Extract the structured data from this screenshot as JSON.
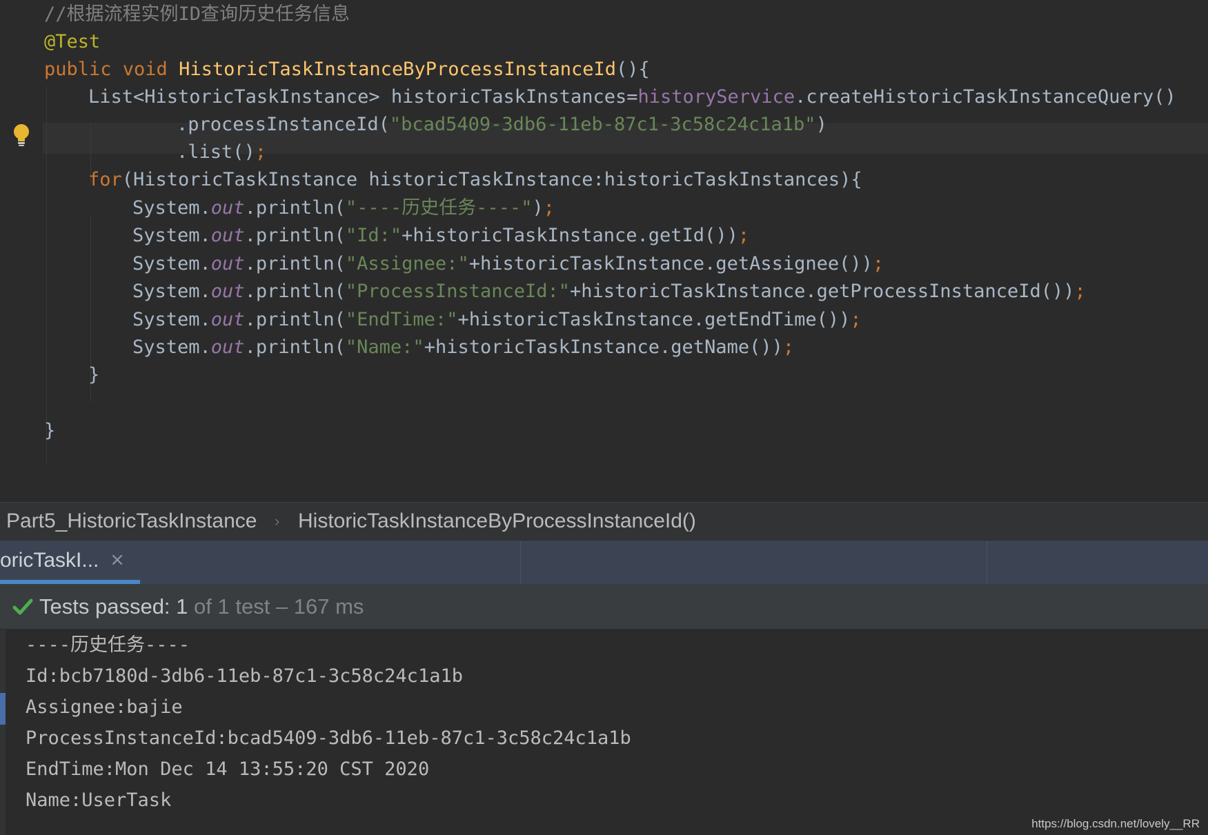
{
  "editor": {
    "lines": [
      {
        "tokens": [
          {
            "t": "comment",
            "v": "//根据流程实例ID查询历史任务信息"
          }
        ]
      },
      {
        "tokens": [
          {
            "t": "annot",
            "v": "@Test"
          }
        ]
      },
      {
        "tokens": [
          {
            "t": "kw",
            "v": "public void "
          },
          {
            "t": "method",
            "v": "HistoricTaskInstanceByProcessInstanceId"
          },
          {
            "t": "plain",
            "v": "(){"
          }
        ]
      },
      {
        "tokens": [
          {
            "t": "plain",
            "v": "List<HistoricTaskInstance> historicTaskInstances="
          },
          {
            "t": "field",
            "v": "historyService"
          },
          {
            "t": "plain",
            "v": ".createHistoricTaskInstanceQuery()"
          }
        ]
      },
      {
        "tokens": [
          {
            "t": "plain",
            "v": ".processInstanceId("
          },
          {
            "t": "str",
            "v": "\"bcad5409-3db6-11eb-87c1-3c58c24c1a1b\""
          },
          {
            "t": "plain",
            "v": ")"
          }
        ]
      },
      {
        "tokens": [
          {
            "t": "plain",
            "v": ".list()"
          },
          {
            "t": "semi",
            "v": ";"
          }
        ]
      },
      {
        "tokens": [
          {
            "t": "kw",
            "v": "for"
          },
          {
            "t": "plain",
            "v": "(HistoricTaskInstance historicTaskInstance:historicTaskInstances){"
          }
        ]
      },
      {
        "tokens": [
          {
            "t": "plain",
            "v": "System."
          },
          {
            "t": "static",
            "v": "out"
          },
          {
            "t": "plain",
            "v": ".println("
          },
          {
            "t": "str",
            "v": "\"----历史任务----\""
          },
          {
            "t": "plain",
            "v": ")"
          },
          {
            "t": "semi",
            "v": ";"
          }
        ]
      },
      {
        "tokens": [
          {
            "t": "plain",
            "v": "System."
          },
          {
            "t": "static",
            "v": "out"
          },
          {
            "t": "plain",
            "v": ".println("
          },
          {
            "t": "str",
            "v": "\"Id:\""
          },
          {
            "t": "plain",
            "v": "+historicTaskInstance.getId())"
          },
          {
            "t": "semi",
            "v": ";"
          }
        ]
      },
      {
        "tokens": [
          {
            "t": "plain",
            "v": "System."
          },
          {
            "t": "static",
            "v": "out"
          },
          {
            "t": "plain",
            "v": ".println("
          },
          {
            "t": "str",
            "v": "\"Assignee:\""
          },
          {
            "t": "plain",
            "v": "+historicTaskInstance.getAssignee())"
          },
          {
            "t": "semi",
            "v": ";"
          }
        ]
      },
      {
        "tokens": [
          {
            "t": "plain",
            "v": "System."
          },
          {
            "t": "static",
            "v": "out"
          },
          {
            "t": "plain",
            "v": ".println("
          },
          {
            "t": "str",
            "v": "\"ProcessInstanceId:\""
          },
          {
            "t": "plain",
            "v": "+historicTaskInstance.getProcessInstanceId())"
          },
          {
            "t": "semi",
            "v": ";"
          }
        ]
      },
      {
        "tokens": [
          {
            "t": "plain",
            "v": "System."
          },
          {
            "t": "static",
            "v": "out"
          },
          {
            "t": "plain",
            "v": ".println("
          },
          {
            "t": "str",
            "v": "\"EndTime:\""
          },
          {
            "t": "plain",
            "v": "+historicTaskInstance.getEndTime())"
          },
          {
            "t": "semi",
            "v": ";"
          }
        ]
      },
      {
        "tokens": [
          {
            "t": "plain",
            "v": "System."
          },
          {
            "t": "static",
            "v": "out"
          },
          {
            "t": "plain",
            "v": ".println("
          },
          {
            "t": "str",
            "v": "\"Name:\""
          },
          {
            "t": "plain",
            "v": "+historicTaskInstance.getName())"
          },
          {
            "t": "semi",
            "v": ";"
          }
        ]
      },
      {
        "tokens": [
          {
            "t": "plain",
            "v": "}"
          }
        ]
      },
      {
        "tokens": []
      },
      {
        "tokens": [
          {
            "t": "plain",
            "v": "}"
          }
        ]
      }
    ]
  },
  "breadcrumb": {
    "class_name": "Part5_HistoricTaskInstance",
    "separator": "›",
    "method_name": "HistoricTaskInstanceByProcessInstanceId()"
  },
  "run_panel": {
    "tab_label": "oricTaskI...",
    "tab_close": "×",
    "status_main": "Tests passed: 1",
    "status_sub": " of 1 test – 167 ms",
    "console_lines": [
      "----历史任务----",
      "Id:bcb7180d-3db6-11eb-87c1-3c58c24c1a1b",
      "Assignee:bajie",
      "ProcessInstanceId:bcad5409-3db6-11eb-87c1-3c58c24c1a1b",
      "EndTime:Mon Dec 14 13:55:20 CST 2020",
      "Name:UserTask"
    ]
  },
  "watermark": "https://blog.csdn.net/lovely__RR",
  "colors": {
    "editor_bg": "#2b2b2b",
    "keyword": "#cc7832",
    "method": "#ffc66d",
    "string": "#6a8759",
    "field": "#9876aa",
    "annotation": "#bbb529",
    "comment": "#808080",
    "success": "#4caf50",
    "tab_accent": "#4a88c7"
  },
  "icons": {
    "intention": "lightbulb-icon",
    "status": "check-icon",
    "close": "close-icon"
  }
}
